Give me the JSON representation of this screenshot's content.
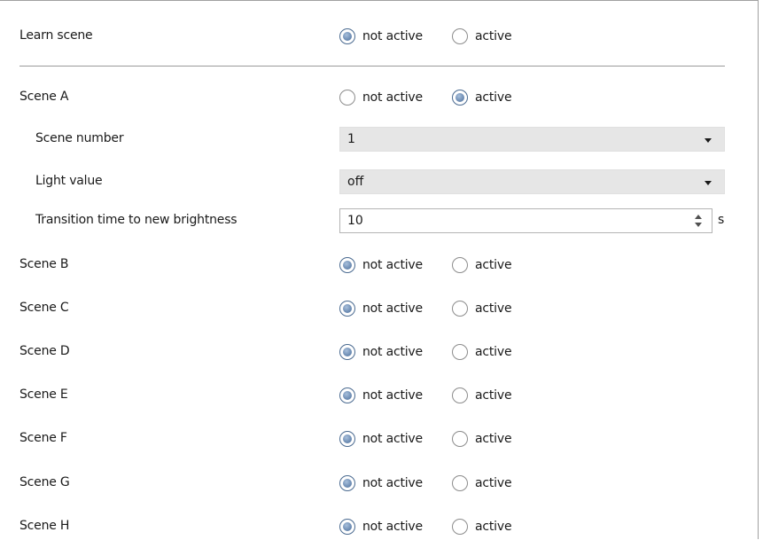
{
  "option_labels": {
    "not_active": "not active",
    "active": "active"
  },
  "learn_scene": {
    "label": "Learn scene",
    "selected": "not_active"
  },
  "scene_a": {
    "label": "Scene A",
    "selected": "active",
    "scene_number": {
      "label": "Scene number",
      "value": "1"
    },
    "light_value": {
      "label": "Light value",
      "value": "off"
    },
    "transition_time": {
      "label": "Transition time to new brightness",
      "value": "10",
      "unit": "s"
    }
  },
  "scenes": [
    {
      "label": "Scene B",
      "selected": "not_active"
    },
    {
      "label": "Scene C",
      "selected": "not_active"
    },
    {
      "label": "Scene D",
      "selected": "not_active"
    },
    {
      "label": "Scene E",
      "selected": "not_active"
    },
    {
      "label": "Scene F",
      "selected": "not_active"
    },
    {
      "label": "Scene G",
      "selected": "not_active"
    },
    {
      "label": "Scene H",
      "selected": "not_active"
    }
  ],
  "colors": {
    "radio_selected": "#6e8db4",
    "dropdown_bg": "#e6e6e6",
    "separator": "#9a9a9a"
  }
}
